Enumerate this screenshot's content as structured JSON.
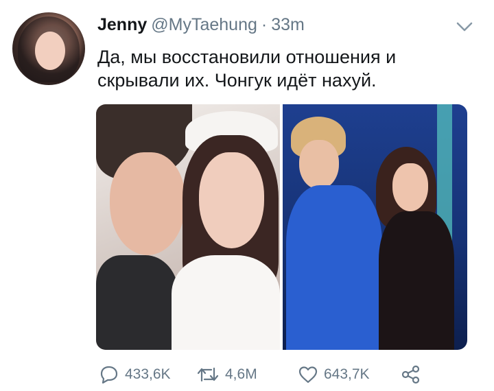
{
  "tweet": {
    "author_name": "Jenny",
    "handle": "@MyTaehung",
    "separator": "·",
    "time": "33m",
    "text": "Да, мы восстановили отношения и\nскрывали их. Чонгук идёт нахуй."
  },
  "actions": {
    "replies": "433,6K",
    "retweets": "4,6M",
    "likes": "643,7K"
  },
  "icons": {
    "menu": "chevron-down-icon",
    "reply": "reply-icon",
    "retweet": "retweet-icon",
    "like": "heart-icon",
    "share": "share-icon"
  },
  "colors": {
    "text": "#14171a",
    "secondary": "#657786"
  }
}
